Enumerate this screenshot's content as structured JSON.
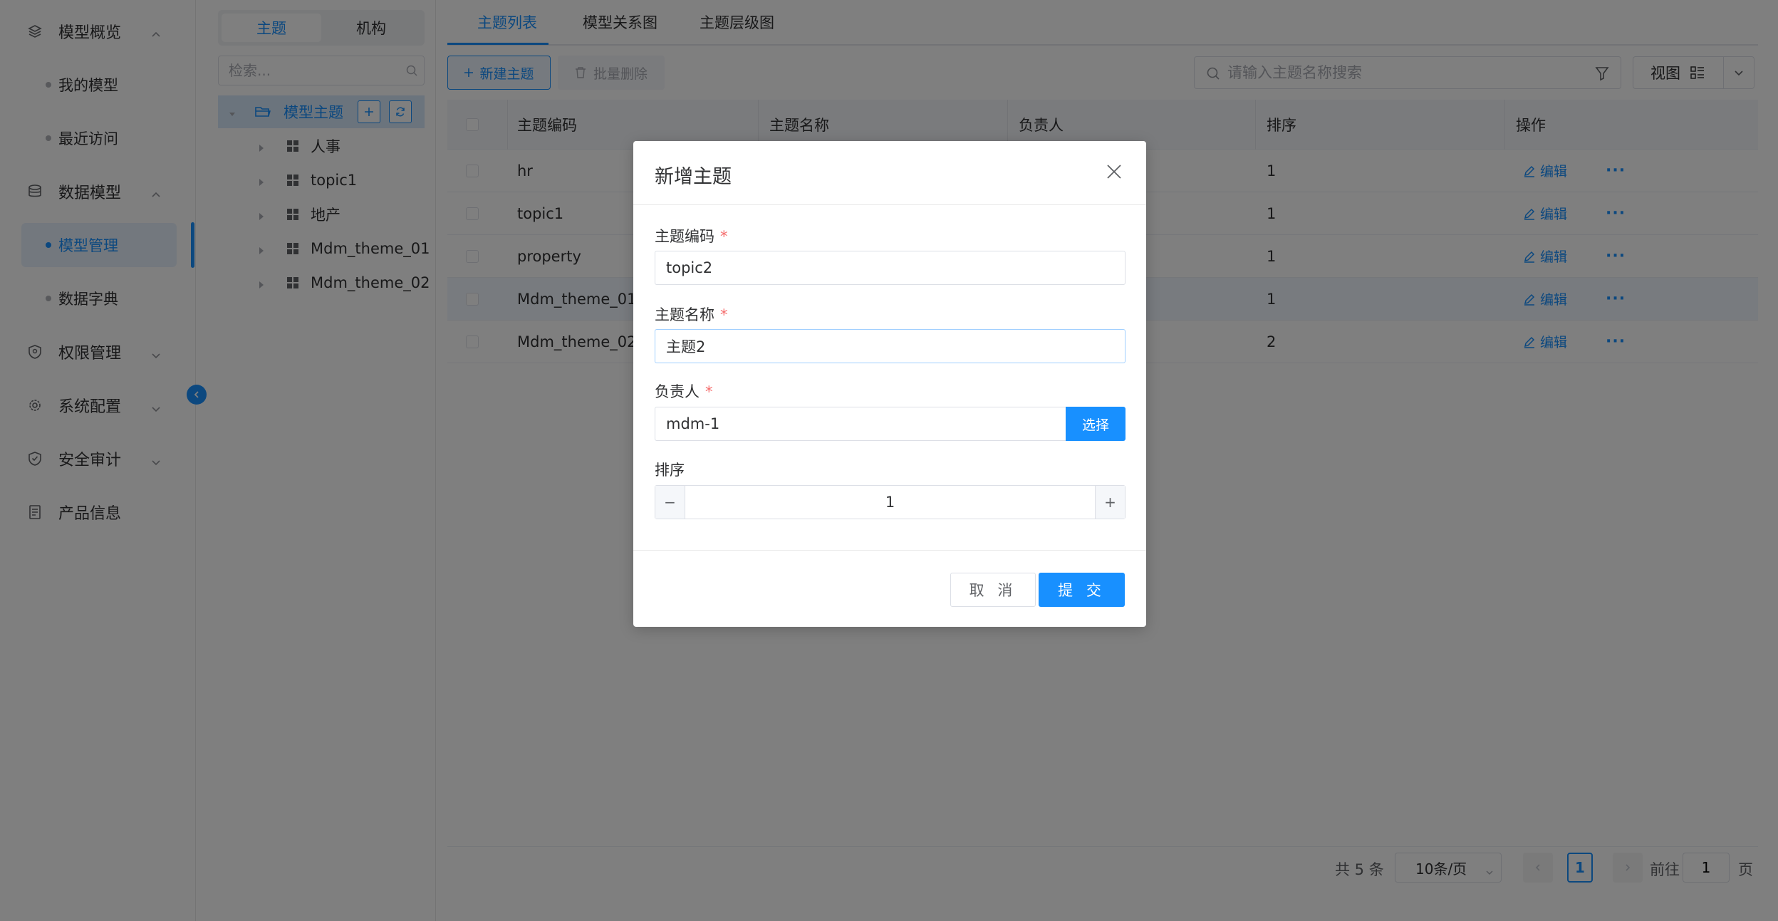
{
  "sidebar": {
    "groups": [
      {
        "label": "模型概览",
        "icon": "layers-icon",
        "expanded": true
      },
      {
        "label": "数据模型",
        "icon": "database-icon",
        "expanded": true
      },
      {
        "label": "权限管理",
        "icon": "shield-icon",
        "expanded": false
      },
      {
        "label": "系统配置",
        "icon": "gear-icon",
        "expanded": false
      },
      {
        "label": "安全审计",
        "icon": "audit-shield-icon",
        "expanded": false
      },
      {
        "label": "产品信息",
        "icon": "document-icon",
        "expanded": false
      }
    ],
    "subitems": {
      "my_model": "我的模型",
      "recent": "最近访问",
      "model_manage": "模型管理",
      "dictionary": "数据字典"
    },
    "active_subitem": "模型管理"
  },
  "tree": {
    "segment": {
      "theme": "主题",
      "org": "机构",
      "active": "主题"
    },
    "search_placeholder": "检索...",
    "root": "模型主题",
    "nodes": [
      "人事",
      "topic1",
      "地产",
      "Mdm_theme_01",
      "Mdm_theme_02"
    ]
  },
  "tabs": {
    "items": [
      "主题列表",
      "模型关系图",
      "主题层级图"
    ],
    "active": "主题列表"
  },
  "toolbar": {
    "new_label": "新建主题",
    "batch_delete_label": "批量删除",
    "search_placeholder": "请输入主题名称搜索",
    "view_label": "视图"
  },
  "table": {
    "headers": {
      "code": "主题编码",
      "name": "主题名称",
      "owner": "负责人",
      "order": "排序",
      "ops": "操作"
    },
    "edit_label": "编辑",
    "more_label": "···",
    "rows": [
      {
        "code": "hr",
        "order": "1"
      },
      {
        "code": "topic1",
        "order": "1"
      },
      {
        "code": "property",
        "order": "1"
      },
      {
        "code": "Mdm_theme_01",
        "order": "1"
      },
      {
        "code": "Mdm_theme_02",
        "order": "2"
      }
    ]
  },
  "pagination": {
    "total": "共 5 条",
    "page_size": "10条/页",
    "current": "1",
    "goto_label": "前往",
    "goto_value": "1",
    "page_suffix": "页"
  },
  "dialog": {
    "title": "新增主题",
    "fields": {
      "code_label": "主题编码",
      "code_value": "topic2",
      "name_label": "主题名称",
      "name_value": "主题2",
      "owner_label": "负责人",
      "owner_value": "mdm-1",
      "pick_label": "选择",
      "order_label": "排序",
      "order_value": "1",
      "required_mark": "*"
    },
    "cancel_label": "取 消",
    "submit_label": "提 交"
  },
  "colors": {
    "accent": "#1890ff",
    "required": "#f56c6c",
    "overlay": "rgba(0,0,0,0.5)"
  }
}
